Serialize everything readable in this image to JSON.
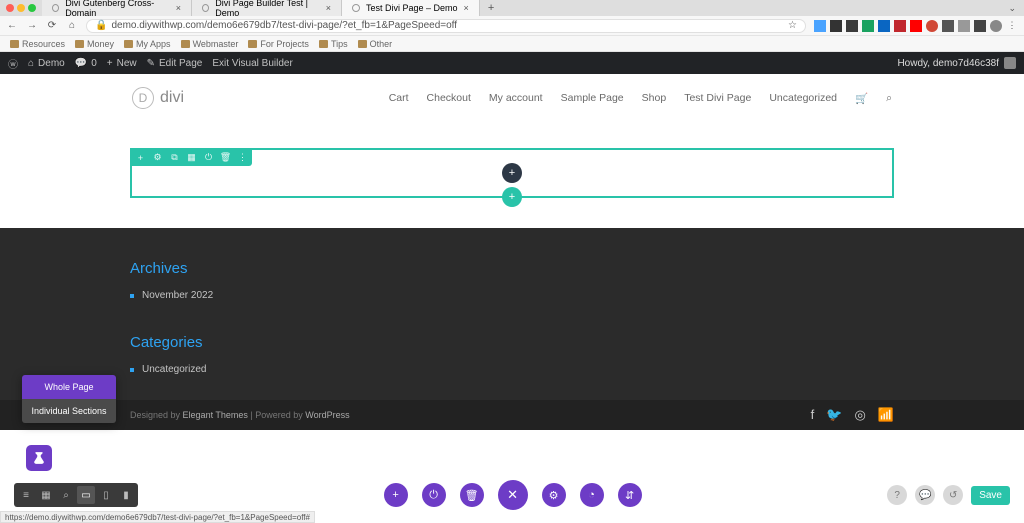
{
  "browser": {
    "tabs": [
      {
        "title": "Divi Gutenberg Cross-Domain"
      },
      {
        "title": "Divi Page Builder Test | Demo"
      },
      {
        "title": "Test Divi Page – Demo"
      }
    ],
    "nav_icons": {
      "back": "←",
      "forward": "→",
      "reload": "⟳",
      "home": "⌂",
      "lock": "🔒",
      "star": "☆"
    },
    "url": "demo.diywithwp.com/demo6e679db7/test-divi-page/?et_fb=1&PageSpeed=off",
    "menu_chevron": "⌄",
    "newtab": "+"
  },
  "bookmarks": [
    "Resources",
    "Money",
    "My Apps",
    "Webmaster",
    "For Projects",
    "Tips",
    "Other"
  ],
  "wp_bar": {
    "wp_icon": "ⓦ",
    "site": "Demo",
    "comments_icon": "💬",
    "comments_count": "0",
    "new_icon": "+",
    "new": "New",
    "edit_icon": "✎",
    "edit": "Edit Page",
    "exit": "Exit Visual Builder",
    "howdy": "Howdy, demo7d46c38f"
  },
  "site": {
    "logo_letter": "D",
    "logo_text": "divi",
    "nav": [
      "Cart",
      "Checkout",
      "My account",
      "Sample Page",
      "Shop",
      "Test Divi Page",
      "Uncategorized"
    ],
    "cart_icon": "🛒",
    "search_icon": "⌕"
  },
  "section_toolbar": {
    "add": "+",
    "settings": "⚙",
    "dup": "⧉",
    "save": "▦",
    "power": "⏻",
    "delete": "🗑",
    "more": "⋮"
  },
  "plus_icons": {
    "dark": "+",
    "teal": "+"
  },
  "footer": {
    "archives_title": "Archives",
    "archives": [
      "November 2022"
    ],
    "categories_title": "Categories",
    "categories": [
      "Uncategorized"
    ],
    "credits": {
      "pre": "Designed by ",
      "a1": "Elegant Themes",
      "mid": " | Powered by ",
      "a2": "WordPress"
    },
    "social_icons": {
      "fb": "f",
      "tw": "🐦",
      "ig": "◎",
      "rss": "📶"
    }
  },
  "ab_menu": {
    "opt1": "Whole Page",
    "opt2": "Individual Sections"
  },
  "builder_bar": {
    "views": {
      "wire": "≡",
      "grid": "▦",
      "zoom": "⌕",
      "desktop": "▭",
      "tablet": "▯",
      "phone": "▮"
    },
    "center": {
      "add": "+",
      "power": "⏻",
      "trash": "🗑",
      "close": "✕",
      "gear": "⚙",
      "clock": "◔",
      "sort": "⇵"
    },
    "right": {
      "help": "?",
      "chat": "💬",
      "undo": "↺"
    },
    "save": "Save"
  },
  "status_url": "https://demo.diywithwp.com/demo6e679db7/test-divi-page/?et_fb=1&PageSpeed=off#",
  "colors": {
    "teal": "#29c3a9",
    "purple": "#6d3cc6",
    "link": "#2ea3f2"
  }
}
